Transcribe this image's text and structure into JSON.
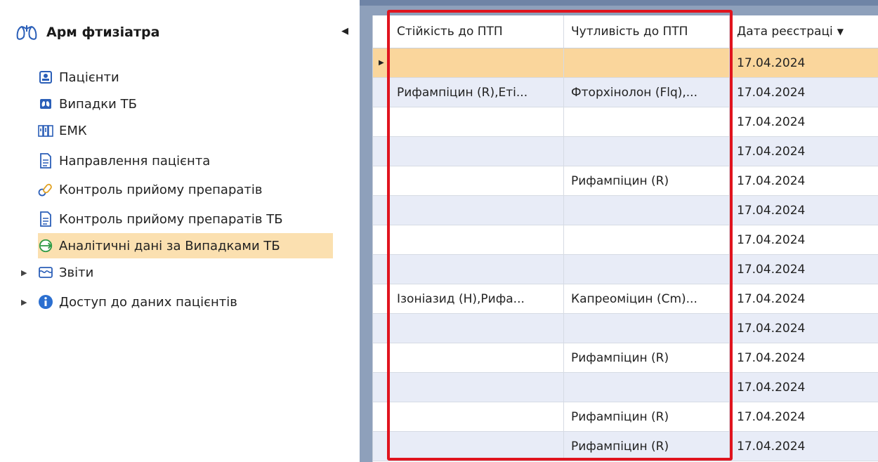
{
  "sidebar": {
    "title": "Арм фтизіатра",
    "items": [
      {
        "label": "Пацієнти",
        "icon": "patient-card-icon"
      },
      {
        "label": "Випадки ТБ",
        "icon": "lungs-icon"
      },
      {
        "label": "ЕМК",
        "icon": "medical-book-icon"
      },
      {
        "label": "Направлення пацієнта",
        "icon": "document-icon"
      },
      {
        "label": "Контроль прийому препаратів",
        "icon": "pills-icon"
      },
      {
        "label": "Контроль прийому препаратів ТБ",
        "icon": "document-icon"
      },
      {
        "label": "Аналітичні дані за Випадками ТБ",
        "icon": "analytics-icon"
      }
    ],
    "groups": [
      {
        "label": "Звіти",
        "icon": "reports-icon"
      },
      {
        "label": "Доступ до даних пацієнтів",
        "icon": "info-icon"
      }
    ]
  },
  "grid": {
    "columns": [
      "Стійкість до ПТП",
      "Чутливість до ПТП",
      "Дата реєстраці"
    ],
    "rows": [
      [
        "",
        "",
        "17.04.2024"
      ],
      [
        "Рифампіцин (R),Еті...",
        "Фторхінолон (Flq),...",
        "17.04.2024"
      ],
      [
        "",
        "",
        "17.04.2024"
      ],
      [
        "",
        "",
        "17.04.2024"
      ],
      [
        "",
        "Рифампіцин (R)",
        "17.04.2024"
      ],
      [
        "",
        "",
        "17.04.2024"
      ],
      [
        "",
        "",
        "17.04.2024"
      ],
      [
        "",
        "",
        "17.04.2024"
      ],
      [
        "Ізоніазид (H),Рифа...",
        "Капреоміцин (Cm)...",
        "17.04.2024"
      ],
      [
        "",
        "",
        "17.04.2024"
      ],
      [
        "",
        "Рифампіцин (R)",
        "17.04.2024"
      ],
      [
        "",
        "",
        "17.04.2024"
      ],
      [
        "",
        "Рифампіцин (R)",
        "17.04.2024"
      ],
      [
        "",
        "Рифампіцин (R)",
        "17.04.2024"
      ]
    ]
  },
  "colors": {
    "selected_bg": "#fbe0b0",
    "active_row": "#fad69c",
    "alt_row": "#e8ecf7",
    "highlight": "#e0141e",
    "brand_blue": "#2b5fb8"
  }
}
